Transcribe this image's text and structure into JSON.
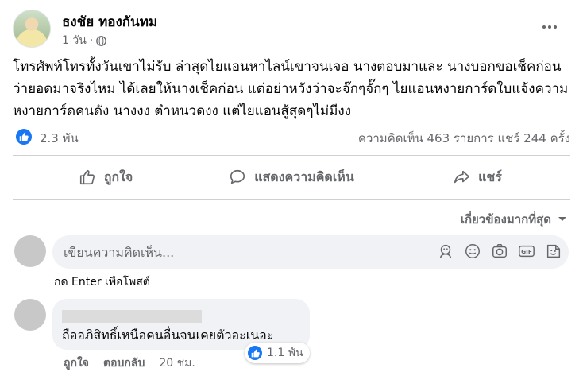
{
  "post": {
    "author": "ธงชัย ทองกันทม",
    "time": "1 วัน",
    "text": "โทรศัพท์โทรทั้งวันเขาไม่รับ ล่าสุดไยแอนหาไลน์เขาจนเจอ นางตอบมาและ นางบอกขอเช็คก่อนว่ายอดมาจริงไหม ได้เลยให้นางเช็คก่อน แต่อย่าหวังว่าจะจ๊กๆจั๊กๆ ไยแอนหงายการ์ดใบแจ้งความ หงายการ์ดคนดัง นางงง ตำหนวดงง แต่ไยแอนสู้สุดๆไม่มีงง",
    "reaction_count": "2.3 พัน",
    "comments_shares": "ความคิดเห็น 463 รายการ  แชร์ 244 ครั้ง"
  },
  "actions": {
    "like": "ถูกใจ",
    "comment": "แสดงความคิดเห็น",
    "share": "แชร์"
  },
  "sort_label": "เกี่ยวข้องมากที่สุด",
  "composer": {
    "placeholder": "เขียนความคิดเห็น...",
    "hint": "กด Enter เพื่อโพสต์"
  },
  "comment": {
    "text": "ถืออภิสิทธิ์เหนือคนอื่นจนเคยตัวอะเนอะ",
    "reactions": "1.1 พัน",
    "like": "ถูกใจ",
    "reply": "ตอบกลับ",
    "time": "20 ชม."
  },
  "icons": [
    "globe-icon",
    "more-icon",
    "like-icon",
    "comment-icon",
    "share-icon",
    "chevron-down-icon",
    "sticker-icon",
    "emoji-icon",
    "camera-icon",
    "gif-icon",
    "avatar-sticker-icon"
  ],
  "colors": {
    "accent": "#1877f2",
    "secondary_text": "#65676b",
    "bubble": "#f0f2f5"
  }
}
